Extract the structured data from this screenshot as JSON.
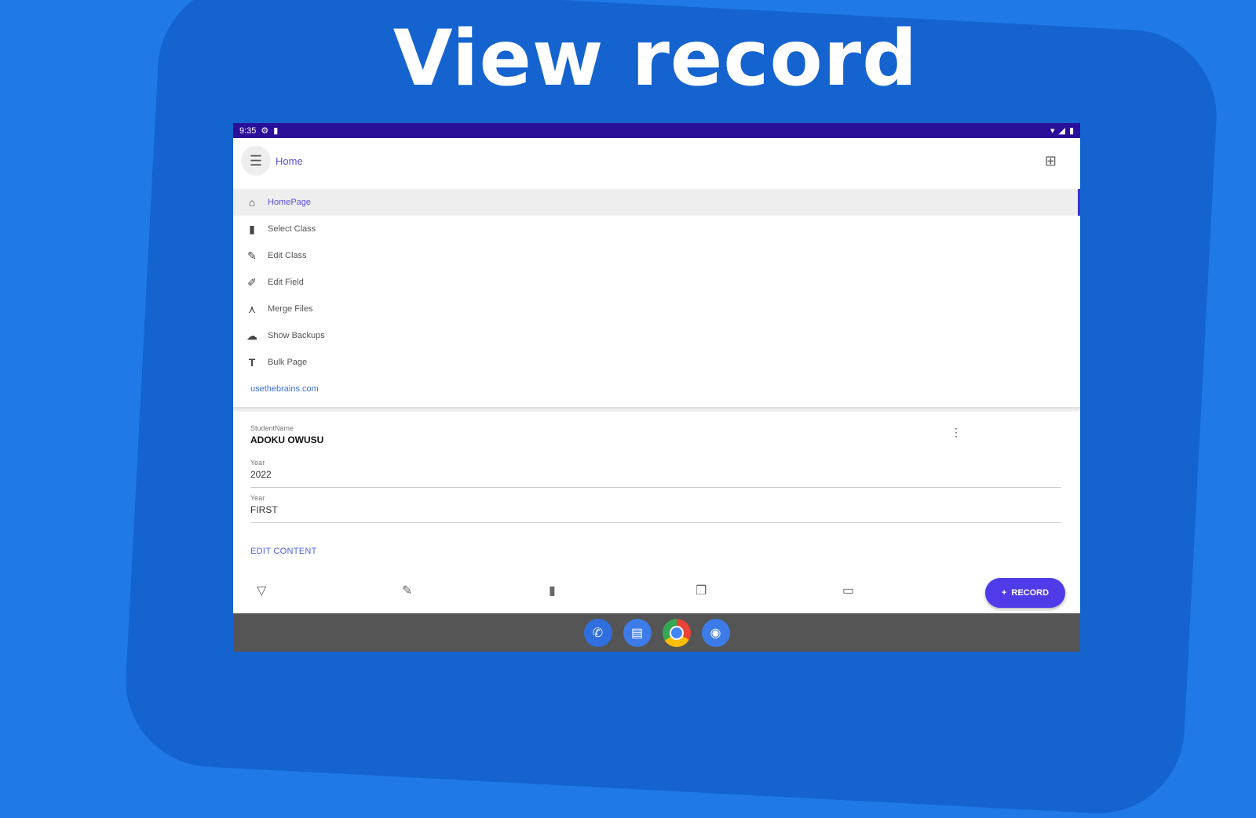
{
  "headline": "View record",
  "status": {
    "time": "9:35",
    "left_icons": [
      "settings-icon",
      "sim-icon"
    ],
    "right_icons": [
      "wifi-icon",
      "signal-icon",
      "battery-icon"
    ]
  },
  "appbar": {
    "title": "Home",
    "menu_icon": "hamburger-icon",
    "action_icon": "grid-icon"
  },
  "drawer": {
    "items": [
      {
        "label": "HomePage",
        "icon": "home-icon",
        "active": true
      },
      {
        "label": "Select Class",
        "icon": "book-icon",
        "active": false
      },
      {
        "label": "Edit Class",
        "icon": "pencil-icon",
        "active": false
      },
      {
        "label": "Edit Field",
        "icon": "edit-field-icon",
        "active": false
      },
      {
        "label": "Merge Files",
        "icon": "merge-icon",
        "active": false
      },
      {
        "label": "Show Backups",
        "icon": "cloud-upload-icon",
        "active": false
      },
      {
        "label": "Bulk Page",
        "icon": "text-format-icon",
        "active": false
      }
    ],
    "site_link": "usethebrains.com"
  },
  "record": {
    "fields": [
      {
        "label": "StudentName",
        "value": "ADOKU OWUSU"
      },
      {
        "label": "Year",
        "value": "2022"
      },
      {
        "label": "Year",
        "value": "FIRST"
      }
    ],
    "edit_label": "EDIT CONTENT"
  },
  "toolbar": {
    "icons": [
      "filter-icon",
      "pencil-icon",
      "book-icon",
      "copy-icon",
      "folder-icon"
    ],
    "fab_label": "RECORD"
  },
  "dock": [
    "phone-icon",
    "messages-icon",
    "chrome-icon",
    "camera-icon"
  ],
  "colors": {
    "background": "#1f7ae8",
    "statusbar": "#2a0f99",
    "accent": "#5a4ee6",
    "fab": "#4f3ce8"
  }
}
